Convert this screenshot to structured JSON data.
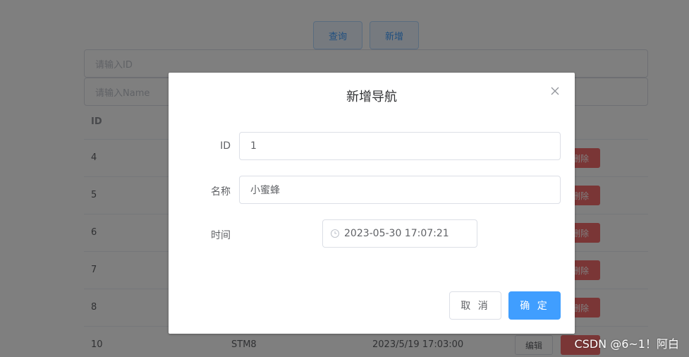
{
  "toolbar": {
    "query_label": "查询",
    "add_label": "新增"
  },
  "filters": {
    "id_placeholder": "请输入ID",
    "name_placeholder": "请输入Name"
  },
  "table": {
    "header_id": "ID",
    "rows": [
      {
        "id": "4",
        "delete_label": "删除"
      },
      {
        "id": "5",
        "delete_label": "删除"
      },
      {
        "id": "6",
        "delete_label": "删除"
      },
      {
        "id": "7",
        "delete_label": "删除"
      },
      {
        "id": "8",
        "delete_label": "删除"
      },
      {
        "id": "10",
        "name": "STM8",
        "time": "2023/5/19 17:03:00",
        "edit_label": "编辑"
      }
    ]
  },
  "dialog": {
    "title": "新增导航",
    "close_icon": "close-icon",
    "fields": {
      "id_label": "ID",
      "id_value": "1",
      "name_label": "名称",
      "name_value": "小蜜蜂",
      "time_label": "时间",
      "time_value": "2023-05-30 17:07:21"
    },
    "cancel_label": "取 消",
    "confirm_label": "确 定"
  },
  "watermark": "CSDN @6~1！阿白",
  "colors": {
    "primary": "#409eff",
    "danger": "#f56c6c",
    "overlay": "rgba(0,0,0,0.5)"
  }
}
